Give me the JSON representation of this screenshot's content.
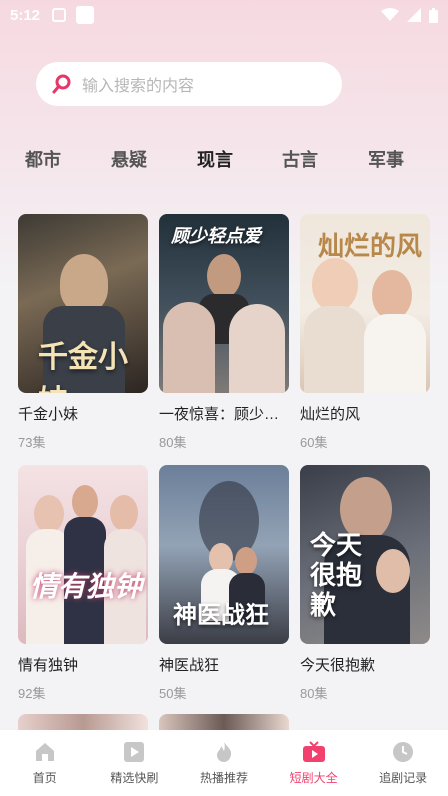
{
  "status": {
    "time": "5:12"
  },
  "search": {
    "placeholder": "输入搜索的内容"
  },
  "tabs": [
    {
      "label": "都市"
    },
    {
      "label": "悬疑"
    },
    {
      "label": "现言"
    },
    {
      "label": "古言"
    },
    {
      "label": "军事"
    }
  ],
  "dramas": [
    {
      "name": "千金小妹",
      "episodes": "73集",
      "poster_text": "千金小妹"
    },
    {
      "name": "一夜惊喜：顾少轻点爱",
      "episodes": "80集",
      "poster_text": "顾少轻点爱"
    },
    {
      "name": "灿烂的风",
      "episodes": "60集",
      "poster_text": "灿烂的风"
    },
    {
      "name": "情有独钟",
      "episodes": "92集",
      "poster_text": "情有独钟"
    },
    {
      "name": "神医战狂",
      "episodes": "50集",
      "poster_text": "神医战狂"
    },
    {
      "name": "今天很抱歉",
      "episodes": "80集",
      "poster_text": "今天很抱歉"
    }
  ],
  "nav": [
    {
      "label": "首页",
      "icon": "home-icon"
    },
    {
      "label": "精选快刷",
      "icon": "play-square-icon"
    },
    {
      "label": "热播推荐",
      "icon": "flame-icon"
    },
    {
      "label": "短剧大全",
      "icon": "tv-icon"
    },
    {
      "label": "追剧记录",
      "icon": "clock-icon"
    }
  ],
  "colors": {
    "accent": "#f2416f"
  }
}
